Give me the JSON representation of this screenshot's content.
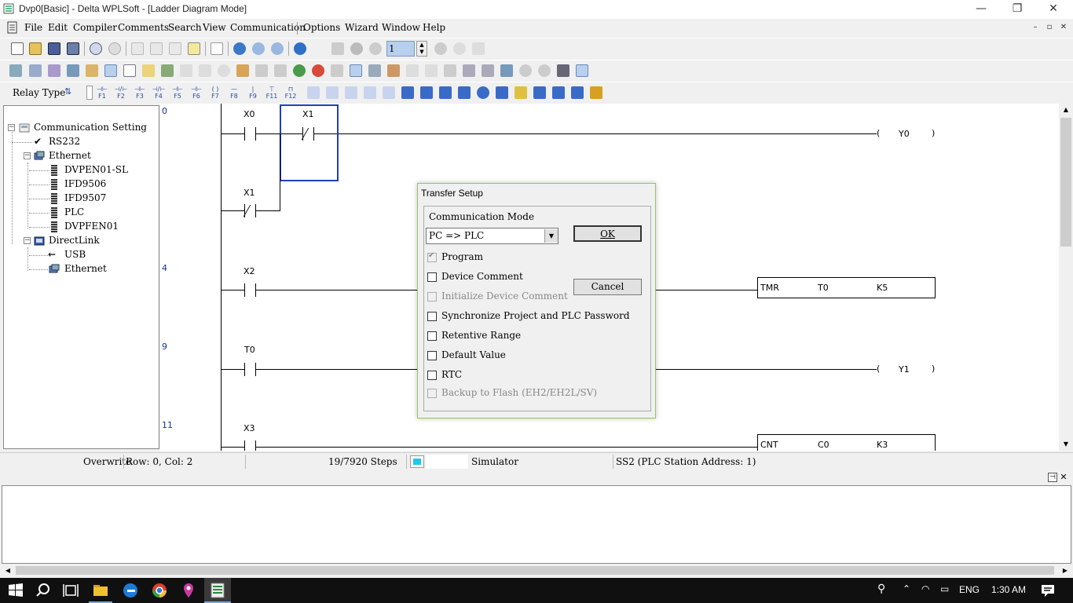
{
  "window": {
    "title": "Dvp0[Basic] - Delta WPLSoft - [Ladder Diagram Mode]",
    "minimize": "—",
    "restore": "❐",
    "close": "✕"
  },
  "menu": {
    "items": [
      {
        "label": "File"
      },
      {
        "label": "Edit"
      },
      {
        "label": "Compiler"
      },
      {
        "label": "Comments"
      },
      {
        "label": "Search"
      },
      {
        "label": "View"
      },
      {
        "label": "Communication"
      },
      {
        "label": "Options"
      },
      {
        "label": "Wizard"
      },
      {
        "label": "Window"
      },
      {
        "label": "Help"
      }
    ],
    "mdi_min": "–",
    "mdi_restore": "▫",
    "mdi_close": "✕"
  },
  "toolbar": {
    "station_value": "1",
    "relay_type_label": "Relay Type",
    "fkeys": [
      "F1",
      "F2",
      "F3",
      "F4",
      "F5",
      "F6",
      "F7",
      "F8",
      "F9",
      "F11",
      "F12"
    ]
  },
  "tree": {
    "root": "Communication Setting",
    "rs232": "RS232",
    "ethernet": "Ethernet",
    "ethernet_children": [
      "DVPEN01-SL",
      "IFD9506",
      "IFD9507",
      "PLC",
      "DVPFEN01"
    ],
    "directlink": "DirectLink",
    "directlink_children": [
      "USB",
      "Ethernet"
    ]
  },
  "ladder": {
    "rung_numbers": [
      "0",
      "4",
      "9",
      "11"
    ],
    "x0": "X0",
    "x1": "X1",
    "x1b": "X1",
    "x2": "X2",
    "t0": "T0",
    "x3": "X3",
    "coil_y0": {
      "open": "(",
      "label": "Y0",
      "close": ")"
    },
    "coil_y1": {
      "open": "(",
      "label": "Y1",
      "close": ")"
    },
    "tmr": {
      "op": "TMR",
      "dev": "T0",
      "val": "K5"
    },
    "cnt": {
      "op": "CNT",
      "dev": "C0",
      "val": "K3"
    }
  },
  "status": {
    "mode": "Overwrite",
    "position": "Row: 0, Col: 2",
    "steps": "19/7920 Steps",
    "sim": "Simulator",
    "station": "SS2 (PLC Station Address: 1)"
  },
  "dialog": {
    "title": "Transfer Setup",
    "group_label": "Communication Mode",
    "mode_value": "PC => PLC",
    "ok": "OK",
    "cancel": "Cancel",
    "options": [
      {
        "label": "Program",
        "checked": true,
        "disabled": true
      },
      {
        "label": "Device Comment",
        "checked": false,
        "disabled": false
      },
      {
        "label": "Initialize Device Comment",
        "checked": false,
        "disabled": true
      },
      {
        "label": "Synchronize Project and PLC Password",
        "checked": false,
        "disabled": false
      },
      {
        "label": "Retentive Range",
        "checked": false,
        "disabled": false
      },
      {
        "label": "Default Value",
        "checked": false,
        "disabled": false
      },
      {
        "label": "RTC",
        "checked": false,
        "disabled": false
      },
      {
        "label": "Backup to Flash (EH2/EH2L/SV)",
        "checked": false,
        "disabled": true
      }
    ]
  },
  "taskbar": {
    "lang": "ENG",
    "time": "1:30 AM"
  },
  "colors": {
    "selection": "#1f3fbf",
    "rungnum": "#1030a0",
    "dialog_border": "#9bc16a"
  }
}
